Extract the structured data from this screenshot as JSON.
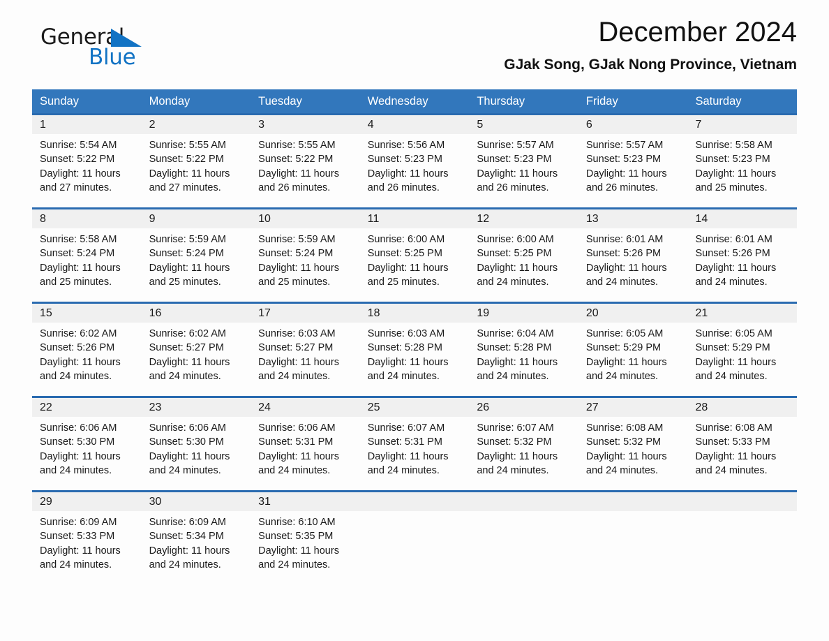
{
  "brand": {
    "name_part1": "General",
    "name_part2": "Blue",
    "logo_icon": "triangle-logo-icon"
  },
  "header": {
    "title": "December 2024",
    "subtitle": "GJak Song, GJak Nong Province, Vietnam"
  },
  "colors": {
    "header_blue": "#3277bc",
    "row_border_blue": "#2a6bb0",
    "day_number_band": "#f0f0f0",
    "brand_blue": "#1273c4"
  },
  "calendar": {
    "weekdays": [
      "Sunday",
      "Monday",
      "Tuesday",
      "Wednesday",
      "Thursday",
      "Friday",
      "Saturday"
    ],
    "weeks": [
      [
        {
          "day": "1",
          "sunrise": "Sunrise: 5:54 AM",
          "sunset": "Sunset: 5:22 PM",
          "daylight": "Daylight: 11 hours and 27 minutes."
        },
        {
          "day": "2",
          "sunrise": "Sunrise: 5:55 AM",
          "sunset": "Sunset: 5:22 PM",
          "daylight": "Daylight: 11 hours and 27 minutes."
        },
        {
          "day": "3",
          "sunrise": "Sunrise: 5:55 AM",
          "sunset": "Sunset: 5:22 PM",
          "daylight": "Daylight: 11 hours and 26 minutes."
        },
        {
          "day": "4",
          "sunrise": "Sunrise: 5:56 AM",
          "sunset": "Sunset: 5:23 PM",
          "daylight": "Daylight: 11 hours and 26 minutes."
        },
        {
          "day": "5",
          "sunrise": "Sunrise: 5:57 AM",
          "sunset": "Sunset: 5:23 PM",
          "daylight": "Daylight: 11 hours and 26 minutes."
        },
        {
          "day": "6",
          "sunrise": "Sunrise: 5:57 AM",
          "sunset": "Sunset: 5:23 PM",
          "daylight": "Daylight: 11 hours and 26 minutes."
        },
        {
          "day": "7",
          "sunrise": "Sunrise: 5:58 AM",
          "sunset": "Sunset: 5:23 PM",
          "daylight": "Daylight: 11 hours and 25 minutes."
        }
      ],
      [
        {
          "day": "8",
          "sunrise": "Sunrise: 5:58 AM",
          "sunset": "Sunset: 5:24 PM",
          "daylight": "Daylight: 11 hours and 25 minutes."
        },
        {
          "day": "9",
          "sunrise": "Sunrise: 5:59 AM",
          "sunset": "Sunset: 5:24 PM",
          "daylight": "Daylight: 11 hours and 25 minutes."
        },
        {
          "day": "10",
          "sunrise": "Sunrise: 5:59 AM",
          "sunset": "Sunset: 5:24 PM",
          "daylight": "Daylight: 11 hours and 25 minutes."
        },
        {
          "day": "11",
          "sunrise": "Sunrise: 6:00 AM",
          "sunset": "Sunset: 5:25 PM",
          "daylight": "Daylight: 11 hours and 25 minutes."
        },
        {
          "day": "12",
          "sunrise": "Sunrise: 6:00 AM",
          "sunset": "Sunset: 5:25 PM",
          "daylight": "Daylight: 11 hours and 24 minutes."
        },
        {
          "day": "13",
          "sunrise": "Sunrise: 6:01 AM",
          "sunset": "Sunset: 5:26 PM",
          "daylight": "Daylight: 11 hours and 24 minutes."
        },
        {
          "day": "14",
          "sunrise": "Sunrise: 6:01 AM",
          "sunset": "Sunset: 5:26 PM",
          "daylight": "Daylight: 11 hours and 24 minutes."
        }
      ],
      [
        {
          "day": "15",
          "sunrise": "Sunrise: 6:02 AM",
          "sunset": "Sunset: 5:26 PM",
          "daylight": "Daylight: 11 hours and 24 minutes."
        },
        {
          "day": "16",
          "sunrise": "Sunrise: 6:02 AM",
          "sunset": "Sunset: 5:27 PM",
          "daylight": "Daylight: 11 hours and 24 minutes."
        },
        {
          "day": "17",
          "sunrise": "Sunrise: 6:03 AM",
          "sunset": "Sunset: 5:27 PM",
          "daylight": "Daylight: 11 hours and 24 minutes."
        },
        {
          "day": "18",
          "sunrise": "Sunrise: 6:03 AM",
          "sunset": "Sunset: 5:28 PM",
          "daylight": "Daylight: 11 hours and 24 minutes."
        },
        {
          "day": "19",
          "sunrise": "Sunrise: 6:04 AM",
          "sunset": "Sunset: 5:28 PM",
          "daylight": "Daylight: 11 hours and 24 minutes."
        },
        {
          "day": "20",
          "sunrise": "Sunrise: 6:05 AM",
          "sunset": "Sunset: 5:29 PM",
          "daylight": "Daylight: 11 hours and 24 minutes."
        },
        {
          "day": "21",
          "sunrise": "Sunrise: 6:05 AM",
          "sunset": "Sunset: 5:29 PM",
          "daylight": "Daylight: 11 hours and 24 minutes."
        }
      ],
      [
        {
          "day": "22",
          "sunrise": "Sunrise: 6:06 AM",
          "sunset": "Sunset: 5:30 PM",
          "daylight": "Daylight: 11 hours and 24 minutes."
        },
        {
          "day": "23",
          "sunrise": "Sunrise: 6:06 AM",
          "sunset": "Sunset: 5:30 PM",
          "daylight": "Daylight: 11 hours and 24 minutes."
        },
        {
          "day": "24",
          "sunrise": "Sunrise: 6:06 AM",
          "sunset": "Sunset: 5:31 PM",
          "daylight": "Daylight: 11 hours and 24 minutes."
        },
        {
          "day": "25",
          "sunrise": "Sunrise: 6:07 AM",
          "sunset": "Sunset: 5:31 PM",
          "daylight": "Daylight: 11 hours and 24 minutes."
        },
        {
          "day": "26",
          "sunrise": "Sunrise: 6:07 AM",
          "sunset": "Sunset: 5:32 PM",
          "daylight": "Daylight: 11 hours and 24 minutes."
        },
        {
          "day": "27",
          "sunrise": "Sunrise: 6:08 AM",
          "sunset": "Sunset: 5:32 PM",
          "daylight": "Daylight: 11 hours and 24 minutes."
        },
        {
          "day": "28",
          "sunrise": "Sunrise: 6:08 AM",
          "sunset": "Sunset: 5:33 PM",
          "daylight": "Daylight: 11 hours and 24 minutes."
        }
      ],
      [
        {
          "day": "29",
          "sunrise": "Sunrise: 6:09 AM",
          "sunset": "Sunset: 5:33 PM",
          "daylight": "Daylight: 11 hours and 24 minutes."
        },
        {
          "day": "30",
          "sunrise": "Sunrise: 6:09 AM",
          "sunset": "Sunset: 5:34 PM",
          "daylight": "Daylight: 11 hours and 24 minutes."
        },
        {
          "day": "31",
          "sunrise": "Sunrise: 6:10 AM",
          "sunset": "Sunset: 5:35 PM",
          "daylight": "Daylight: 11 hours and 24 minutes."
        },
        {
          "day": "",
          "sunrise": "",
          "sunset": "",
          "daylight": ""
        },
        {
          "day": "",
          "sunrise": "",
          "sunset": "",
          "daylight": ""
        },
        {
          "day": "",
          "sunrise": "",
          "sunset": "",
          "daylight": ""
        },
        {
          "day": "",
          "sunrise": "",
          "sunset": "",
          "daylight": ""
        }
      ]
    ]
  }
}
